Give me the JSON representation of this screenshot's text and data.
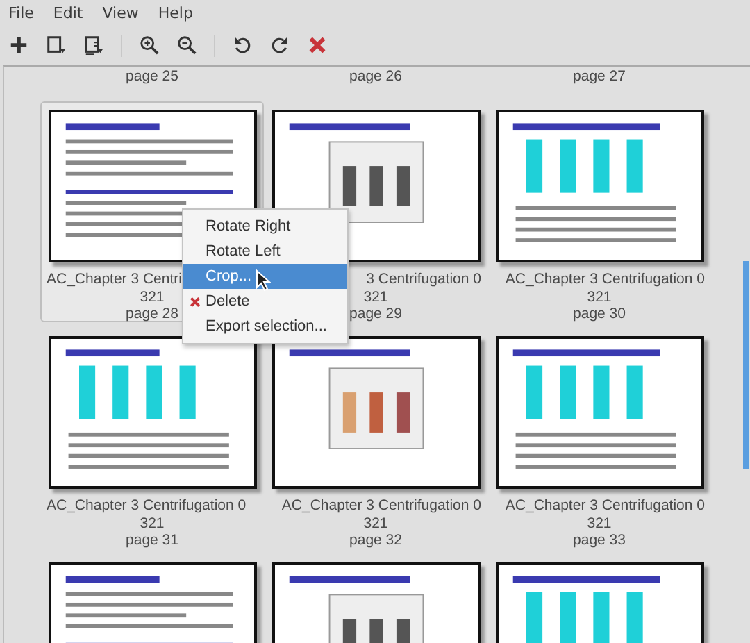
{
  "menu": [
    "File",
    "Edit",
    "View",
    "Help"
  ],
  "previous_row_labels": [
    "page 25",
    "page 26",
    "page 27"
  ],
  "pages": [
    {
      "name_line_1": "AC_Chapter 3 Centri",
      "name_line_2": "321",
      "page": "page 28",
      "selected": true
    },
    {
      "name_line_1": "3 Centrifugation 0",
      "name_line_2": "321",
      "page": "page 29",
      "selected": false
    },
    {
      "name_line_1": "AC_Chapter 3 Centrifugation 0",
      "name_line_2": "321",
      "page": "page 30",
      "selected": false
    },
    {
      "name_line_1": "AC_Chapter 3 Centrifugation 0",
      "name_line_2": "321",
      "page": "page 31",
      "selected": false
    },
    {
      "name_line_1": "AC_Chapter 3 Centrifugation 0",
      "name_line_2": "321",
      "page": "page 32",
      "selected": false
    },
    {
      "name_line_1": "AC_Chapter 3 Centrifugation 0",
      "name_line_2": "321",
      "page": "page 33",
      "selected": false
    },
    {
      "selected": false
    },
    {
      "selected": false
    },
    {
      "selected": false
    }
  ],
  "context_menu": [
    {
      "label": "Rotate Right",
      "kind": "plain",
      "selected": false
    },
    {
      "label": "Rotate Left",
      "kind": "plain",
      "selected": false
    },
    {
      "label": "Crop...",
      "kind": "plain",
      "selected": true
    },
    {
      "label": "Delete",
      "kind": "delete",
      "selected": false
    },
    {
      "label": "Export selection...",
      "kind": "plain",
      "selected": false
    }
  ]
}
